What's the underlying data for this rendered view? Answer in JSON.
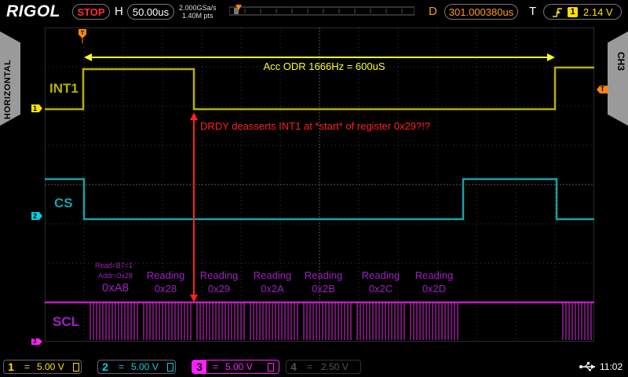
{
  "header": {
    "brand": "RIGOL",
    "run_state": "STOP",
    "h_label": "H",
    "timebase": "50.00us",
    "sample_rate": "2.000GSa/s",
    "memory_depth": "1.40M pts",
    "d_label": "D",
    "delay": "301.000380us",
    "t_label": "T",
    "trigger_channel": "1",
    "trigger_level": "2.14 V"
  },
  "side": {
    "left_tab": "HORIZONTAL",
    "right_tab": "CH3"
  },
  "markers": {
    "ch1": "1",
    "ch2": "2",
    "ch3": "3",
    "trigger": "T"
  },
  "channels": [
    {
      "num": "1",
      "coupling": "=",
      "scale": "5.00 V",
      "color": "#ffe000"
    },
    {
      "num": "2",
      "coupling": "=",
      "scale": "5.00 V",
      "color": "#00d0e8"
    },
    {
      "num": "3",
      "coupling": "=",
      "scale": "5.00 V",
      "color": "#ff20ff"
    },
    {
      "num": "4",
      "coupling": "=",
      "scale": "2.50 V",
      "color": "#555555"
    }
  ],
  "clock": "11:02",
  "annotations": {
    "odr": "Acc ODR 1666Hz = 600uS",
    "drdy": "DRDY deasserts INT1 at *start* of register 0x29?!?",
    "int1": "INT1",
    "cs": "CS",
    "scl": "SCL",
    "read_note_1": "Read=B7=1",
    "read_note_2": "Addr=0x28",
    "first_byte": "0xA8",
    "reading_word": "Reading",
    "regs": [
      "0x28",
      "0x29",
      "0x2A",
      "0x2B",
      "0x2C",
      "0x2D"
    ]
  },
  "colors": {
    "ch1": "#b6b000",
    "ch2": "#1aa0a8",
    "ch3": "#c020c0",
    "annot_yellow": "#ffff20",
    "annot_red": "#ff2020",
    "annot_purple": "#a020c0",
    "trigger_marker": "#ff8800"
  }
}
